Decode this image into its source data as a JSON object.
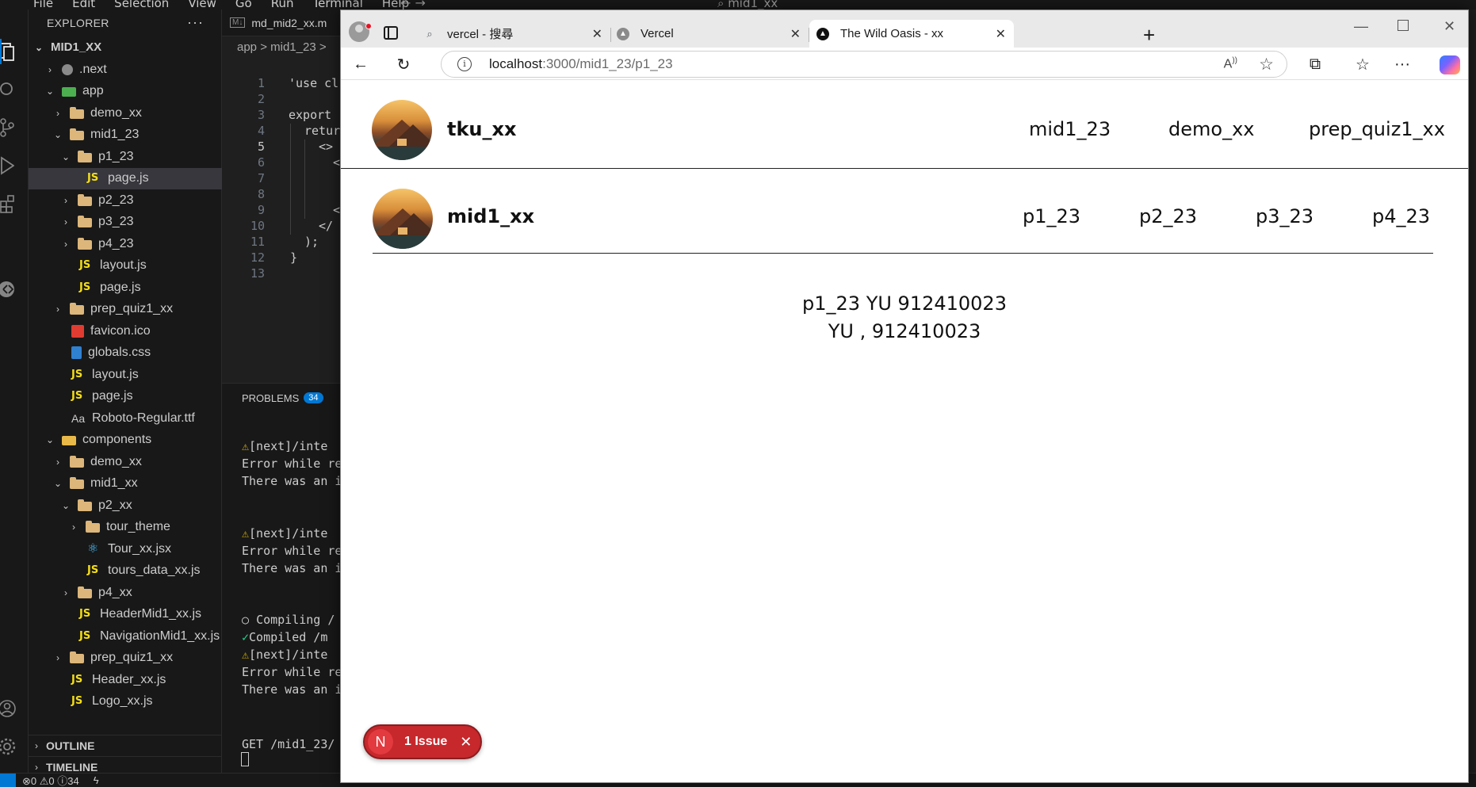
{
  "vscode": {
    "menu": [
      "File",
      "Edit",
      "Selection",
      "View",
      "Go",
      "Run",
      "Terminal",
      "Help"
    ],
    "title": "mid1_xx",
    "explorer_title": "EXPLORER",
    "project": "MID1_XX",
    "tree": [
      {
        "label": ".next"
      },
      {
        "label": "app"
      },
      {
        "label": "demo_xx"
      },
      {
        "label": "mid1_23"
      },
      {
        "label": "p1_23"
      },
      {
        "label": "page.js"
      },
      {
        "label": "p2_23"
      },
      {
        "label": "p3_23"
      },
      {
        "label": "p4_23"
      },
      {
        "label": "layout.js"
      },
      {
        "label": "page.js"
      },
      {
        "label": "prep_quiz1_xx"
      },
      {
        "label": "favicon.ico"
      },
      {
        "label": "globals.css"
      },
      {
        "label": "layout.js"
      },
      {
        "label": "page.js"
      },
      {
        "label": "Roboto-Regular.ttf"
      },
      {
        "label": "components"
      },
      {
        "label": "demo_xx"
      },
      {
        "label": "mid1_xx"
      },
      {
        "label": "p2_xx"
      },
      {
        "label": "tour_theme"
      },
      {
        "label": "Tour_xx.jsx"
      },
      {
        "label": "tours_data_xx.js"
      },
      {
        "label": "p4_xx"
      },
      {
        "label": "HeaderMid1_xx.js"
      },
      {
        "label": "NavigationMid1_xx.js"
      },
      {
        "label": "prep_quiz1_xx"
      },
      {
        "label": "Header_xx.js"
      },
      {
        "label": "Logo_xx.js"
      }
    ],
    "outline": "OUTLINE",
    "timeline": "TIMELINE",
    "editor_tab": "md_mid2_xx.m",
    "breadcrumb": "app > mid1_23 >",
    "code_lines": {
      "l1": "'use cl",
      "l3a": "export",
      "l4a": "retur",
      "l5": "<>",
      "l6": "<",
      "l9": "<",
      "l10": "</",
      "l11": ");",
      "l12": "}"
    },
    "panel": {
      "problems_label": "PROBLEMS",
      "problems_count": "34",
      "lines": {
        "w1": "[next]/inte",
        "e1": "Error while re",
        "t1": "There was an i",
        "w2": "[next]/inte",
        "e2": "Error while re",
        "t2": "There was an i",
        "c1": "Compiling /",
        "c2": "Compiled /m",
        "w3": "[next]/inte",
        "e3": "Error while re",
        "t3": "There was an i",
        "get": "GET /mid1_23/"
      }
    },
    "status": {
      "errors": "0",
      "warnings": "0",
      "info": "34"
    }
  },
  "browser": {
    "tabs": [
      {
        "label": "vercel - 搜尋"
      },
      {
        "label": "Vercel"
      },
      {
        "label": "The Wild Oasis - xx"
      }
    ],
    "url_host": "localhost",
    "url_path": ":3000/mid1_23/p1_23",
    "page": {
      "brand": "tku_xx",
      "nav": [
        "mid1_23",
        "demo_xx",
        "prep_quiz1_xx"
      ],
      "sub_brand": "mid1_xx",
      "sub_nav": [
        "p1_23",
        "p2_23",
        "p3_23",
        "p4_23"
      ],
      "line1": "p1_23 YU 912410023",
      "line2": "YU , 912410023"
    },
    "issue": {
      "icon": "N",
      "label": "1 Issue"
    }
  },
  "colors": {
    "accent": "#0078d4",
    "issue": "#c6282c"
  }
}
